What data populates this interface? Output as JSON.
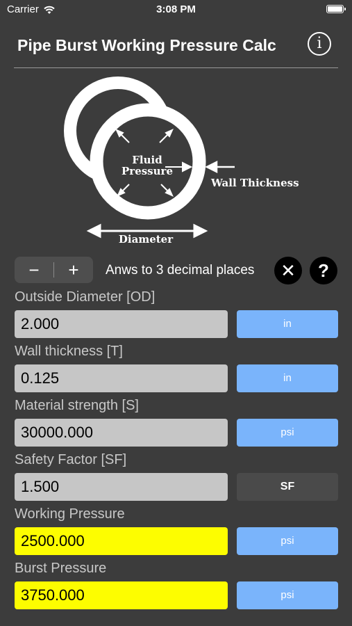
{
  "status_bar": {
    "carrier": "Carrier",
    "time": "3:08 PM"
  },
  "header": {
    "title": "Pipe Burst Working Pressure Calc",
    "info_glyph": "i"
  },
  "diagram": {
    "fluid_label_1": "Fluid",
    "fluid_label_2": "Pressure",
    "wall_label": "Wall Thickness",
    "diameter_label": "Diameter"
  },
  "controls": {
    "minus": "−",
    "plus": "+",
    "decimal_text": "Anws to 3 decimal places",
    "clear_glyph": "✕",
    "help_glyph": "?"
  },
  "fields": [
    {
      "label": "Outside Diameter [OD]",
      "value": "2.000",
      "unit": "in"
    },
    {
      "label": "Wall thickness [T]",
      "value": "0.125",
      "unit": "in"
    },
    {
      "label": "Material strength [S]",
      "value": "30000.000",
      "unit": "psi"
    },
    {
      "label": "Safety Factor [SF]",
      "value": "1.500",
      "unit": "SF"
    },
    {
      "label": "Working Pressure",
      "value": "2500.000",
      "unit": "psi"
    },
    {
      "label": "Burst Pressure",
      "value": "3750.000",
      "unit": "psi"
    }
  ],
  "colors": {
    "background": "#3c3c3c",
    "input_bg": "#c6c6c6",
    "result_bg": "#fdfd00",
    "unit_button": "#7ab4fb"
  }
}
